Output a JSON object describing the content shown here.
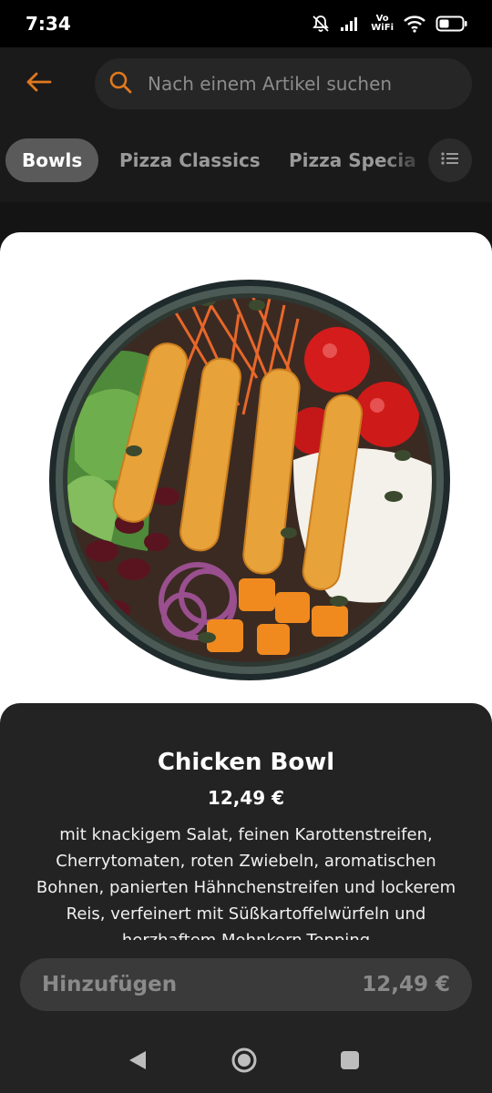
{
  "status": {
    "time": "7:34",
    "vowifi_top": "Vo",
    "vowifi_bottom": "WiFi"
  },
  "search": {
    "placeholder": "Nach einem Artikel suchen"
  },
  "categories": [
    {
      "label": "Bowls",
      "active": true
    },
    {
      "label": "Pizza Classics",
      "active": false
    },
    {
      "label": "Pizza Specia",
      "active": false
    }
  ],
  "product": {
    "name": "Chicken Bowl",
    "price": "12,49 €",
    "description": "mit knackigem Salat, feinen Karottenstreifen, Cherrytomaten, roten Zwiebeln, aromatischen Bohnen, panierten Hähnchenstreifen und lockerem Reis, verfeinert mit Süßkartoffelwürfeln und herzhaftem Mohnkorn-Topping"
  },
  "cart": {
    "add_label": "Hinzufügen",
    "total": "12,49 €"
  },
  "colors": {
    "accent": "#e0781e",
    "background": "#141414",
    "panel": "#232323"
  },
  "icons": [
    "arrow-left-icon",
    "search-icon",
    "list-filter-icon",
    "bell-off-icon",
    "signal-icon",
    "wifi-icon",
    "battery-icon",
    "nav-back-icon",
    "nav-home-icon",
    "nav-recents-icon"
  ]
}
